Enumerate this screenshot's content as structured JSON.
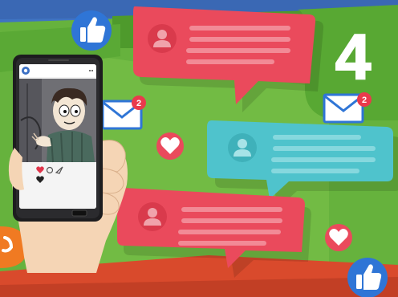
{
  "overlays": {
    "big_number": "4",
    "mail_badge_left": "2",
    "mail_badge_right": "2"
  },
  "colors": {
    "grass": "#66b23d",
    "grass_dark": "#4e9a2c",
    "sky": "#3f74c2",
    "bubble_red": "#ea4a5c",
    "bubble_teal": "#4fc3cc",
    "orange": "#f07a22",
    "bottom_red": "#d94a2c"
  },
  "icons": [
    "thumbs-up-icon",
    "mail-icon",
    "heart-icon",
    "user-icon",
    "smartphone",
    "hand"
  ]
}
